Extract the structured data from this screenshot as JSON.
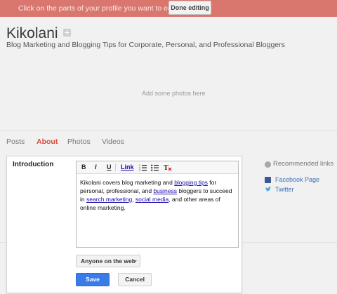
{
  "edit_bar": {
    "message": "Click on the parts of your profile you want to edit.",
    "done_label": "Done editing",
    "color": "#d9776f"
  },
  "profile": {
    "name": "Kikolani",
    "tagline": "Blog Marketing and Blogging Tips for Corporate, Personal, and Professional Bloggers",
    "photos_hint": "Add some photos here"
  },
  "tabs": [
    {
      "label": "Posts",
      "active": false
    },
    {
      "label": "About",
      "active": true
    },
    {
      "label": "Photos",
      "active": false
    },
    {
      "label": "Videos",
      "active": false
    }
  ],
  "intro": {
    "label": "Introduction",
    "toolbar": {
      "bold": "B",
      "italic": "I",
      "underline": "U",
      "link": "Link"
    },
    "body": {
      "t1": "Kikolani covers blog marketing and ",
      "l1": "blogging tips",
      "t2": " for personal, professional, and ",
      "l2": "business",
      "t3": " bloggers to succeed in ",
      "l3": "search marketing",
      "t4": ", ",
      "l4": "social media",
      "t5": ", and other areas of online marketing."
    },
    "visibility": "Anyone on the web",
    "save_label": "Save",
    "cancel_label": "Cancel"
  },
  "recommended": {
    "heading": "Recommended links",
    "links": [
      "Facebook Page",
      "Twitter"
    ]
  },
  "colors": {
    "accent": "#dd4b39",
    "save_blue": "#3a7bea",
    "link": "#1a0dab"
  }
}
